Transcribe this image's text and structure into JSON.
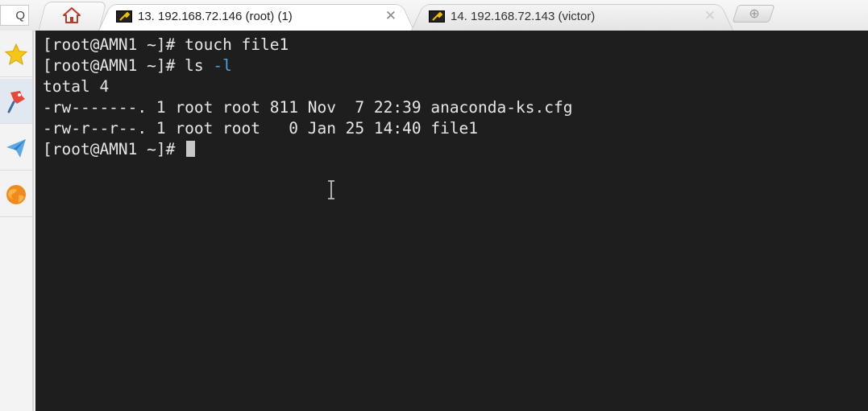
{
  "search": {
    "icon": "search-icon",
    "glyph": "Q"
  },
  "tabs": [
    {
      "title": "13. 192.168.72.146 (root) (1)",
      "icon": "putty-wrench-icon",
      "close": "✕",
      "active": true
    },
    {
      "title": "14. 192.168.72.143 (victor)",
      "icon": "putty-wrench-icon",
      "close": "✕",
      "active": false
    }
  ],
  "home": {
    "icon": "home-icon"
  },
  "new_tab": {
    "icon": "plus-icon",
    "glyph": "⊕"
  },
  "sidebar": {
    "items": [
      {
        "icon": "star-icon"
      },
      {
        "icon": "pin-icon"
      },
      {
        "icon": "send-icon"
      },
      {
        "icon": "globe-icon"
      }
    ]
  },
  "terminal": {
    "lines": [
      {
        "prompt": "[root@AMN1 ~]# ",
        "text": "touch file1"
      },
      {
        "prompt": "[root@AMN1 ~]# ",
        "text": "ls ",
        "option": "-l"
      },
      {
        "prompt": "",
        "text": "total 4"
      },
      {
        "prompt": "",
        "text": "-rw-------. 1 root root 811 Nov  7 22:39 anaconda-ks.cfg"
      },
      {
        "prompt": "",
        "text": "-rw-r--r--. 1 root root   0 Jan 25 14:40 file1"
      },
      {
        "prompt": "[root@AMN1 ~]# ",
        "text": ""
      }
    ],
    "colors": {
      "background": "#1e1e1e",
      "foreground": "#e6e6e6",
      "option": "#4aa3df",
      "cursor": "#c8c8c8"
    }
  }
}
